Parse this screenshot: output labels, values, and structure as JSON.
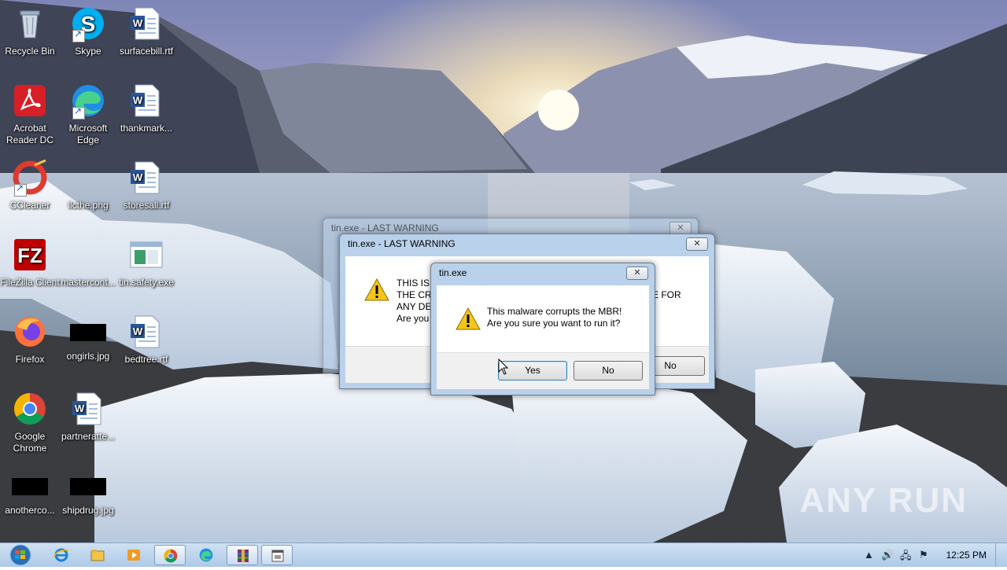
{
  "desktop": {
    "icons": [
      {
        "label": "Recycle Bin",
        "icon": "recycle-bin-icon"
      },
      {
        "label": "Skype",
        "icon": "skype-icon"
      },
      {
        "label": "surfacebill.rtf",
        "icon": "word-document-icon"
      },
      {
        "label": "Acrobat Reader DC",
        "icon": "acrobat-icon"
      },
      {
        "label": "Microsoft Edge",
        "icon": "edge-icon"
      },
      {
        "label": "thankmark...",
        "icon": "word-document-icon"
      },
      {
        "label": "CCleaner",
        "icon": "ccleaner-icon"
      },
      {
        "label": "llcthe.png",
        "icon": "image-file-icon"
      },
      {
        "label": "storesall.rtf",
        "icon": "word-document-icon"
      },
      {
        "label": "FileZilla Client",
        "icon": "filezilla-icon"
      },
      {
        "label": "mastercont...",
        "icon": "image-file-icon"
      },
      {
        "label": "tin.safety.exe",
        "icon": "exe-icon"
      },
      {
        "label": "Firefox",
        "icon": "firefox-icon"
      },
      {
        "label": "ongirls.jpg",
        "icon": "image-file-icon"
      },
      {
        "label": "bedtree.rtf",
        "icon": "word-document-icon"
      },
      {
        "label": "Google Chrome",
        "icon": "chrome-icon"
      },
      {
        "label": "partneratte...",
        "icon": "word-document-icon"
      },
      {
        "label": "anotherco...",
        "icon": "image-file-icon"
      },
      {
        "label": "shipdrug.jpg",
        "icon": "image-file-icon"
      }
    ]
  },
  "windows": {
    "back": {
      "title": "tin.exe - LAST WARNING"
    },
    "middle": {
      "title": "tin.exe - LAST WARNING",
      "line1": "THIS IS T",
      "line2": "THE CRI",
      "line3": "ANY DE",
      "line4": "Are you",
      "right_text": "E FOR",
      "no_label": "No"
    },
    "front": {
      "title": "tin.exe",
      "message": "This malware corrupts the MBR!\nAre you sure you want to run it?",
      "yes_label": "Yes",
      "no_label": "No"
    }
  },
  "taskbar": {
    "clock": "12:25 PM"
  },
  "watermark": "ANY RUN",
  "colors": {
    "accent": "#3c7fb1",
    "taskbar": "#aec9e6",
    "window_frame": "#b9d1ea"
  }
}
